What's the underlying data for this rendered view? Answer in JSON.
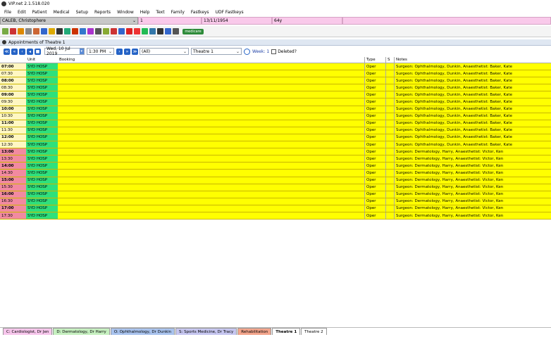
{
  "window": {
    "title": "VIP.net 2.1.518.020"
  },
  "menu": [
    "File",
    "Edit",
    "Patient",
    "Medical",
    "Setup",
    "Reports",
    "Window",
    "Help",
    "Text",
    "Family",
    "Fastkeys",
    "UDF Fastkeys"
  ],
  "patient": {
    "name": "CALEB, Christophere",
    "id": "1",
    "dob": "13/11/1954",
    "age": "64y"
  },
  "toolbar": {
    "logo_text": "medicare"
  },
  "panel": {
    "title": "Appointments of Theatre 1"
  },
  "controls": {
    "date": "Wed, 10 Jul 2019",
    "time": "1:30 PM",
    "filter": "(All)",
    "location": "Theatre 1",
    "week_label": "Week: 1",
    "deleted_label": "Deleted?"
  },
  "grid": {
    "headers": {
      "time": "",
      "unit": "Unit",
      "booking": "Booking",
      "type": "Type",
      "s": "S",
      "notes": "Notes"
    },
    "rows": [
      {
        "time": "07:00",
        "unit": "SYD HOSP",
        "type": "Oper",
        "notes": "Surgeon: Ophthalmology, Dunkin, Anaesthetist: Baker, Kate"
      },
      {
        "time": "07:30",
        "unit": "SYD HOSP",
        "type": "Oper",
        "notes": "Surgeon: Ophthalmology, Dunkin, Anaesthetist: Baker, Kate"
      },
      {
        "time": "08:00",
        "unit": "SYD HOSP",
        "type": "Oper",
        "notes": "Surgeon: Ophthalmology, Dunkin, Anaesthetist: Baker, Kate"
      },
      {
        "time": "08:30",
        "unit": "SYD HOSP",
        "type": "Oper",
        "notes": "Surgeon: Ophthalmology, Dunkin, Anaesthetist: Baker, Kate"
      },
      {
        "time": "09:00",
        "unit": "SYD HOSP",
        "type": "Oper",
        "notes": "Surgeon: Ophthalmology, Dunkin, Anaesthetist: Baker, Kate"
      },
      {
        "time": "09:30",
        "unit": "SYD HOSP",
        "type": "Oper",
        "notes": "Surgeon: Ophthalmology, Dunkin, Anaesthetist: Baker, Kate"
      },
      {
        "time": "10:00",
        "unit": "SYD HOSP",
        "type": "Oper",
        "notes": "Surgeon: Ophthalmology, Dunkin, Anaesthetist: Baker, Kate"
      },
      {
        "time": "10:30",
        "unit": "SYD HOSP",
        "type": "Oper",
        "notes": "Surgeon: Ophthalmology, Dunkin, Anaesthetist: Baker, Kate"
      },
      {
        "time": "11:00",
        "unit": "SYD HOSP",
        "type": "Oper",
        "notes": "Surgeon: Ophthalmology, Dunkin, Anaesthetist: Baker, Kate"
      },
      {
        "time": "11:30",
        "unit": "SYD HOSP",
        "type": "Oper",
        "notes": "Surgeon: Ophthalmology, Dunkin, Anaesthetist: Baker, Kate"
      },
      {
        "time": "12:00",
        "unit": "SYD HOSP",
        "type": "Oper",
        "notes": "Surgeon: Ophthalmology, Dunkin, Anaesthetist: Baker, Kate"
      },
      {
        "time": "12:30",
        "unit": "SYD HOSP",
        "type": "Oper",
        "notes": "Surgeon: Ophthalmology, Dunkin, Anaesthetist: Baker, Kate"
      },
      {
        "time": "13:00",
        "unit": "SYD HOSP",
        "type": "Oper",
        "notes": "Surgeon: Dermatology, Harry, Anaesthetist: Victor, Ken"
      },
      {
        "time": "13:30",
        "unit": "SYD HOSP",
        "type": "Oper",
        "notes": "Surgeon: Dermatology, Harry, Anaesthetist: Victor, Ken"
      },
      {
        "time": "14:00",
        "unit": "SYD HOSP",
        "type": "Oper",
        "notes": "Surgeon: Dermatology, Harry, Anaesthetist: Victor, Ken"
      },
      {
        "time": "14:30",
        "unit": "SYD HOSP",
        "type": "Oper",
        "notes": "Surgeon: Dermatology, Harry, Anaesthetist: Victor, Ken"
      },
      {
        "time": "15:00",
        "unit": "SYD HOSP",
        "type": "Oper",
        "notes": "Surgeon: Dermatology, Harry, Anaesthetist: Victor, Ken"
      },
      {
        "time": "15:30",
        "unit": "SYD HOSP",
        "type": "Oper",
        "notes": "Surgeon: Dermatology, Harry, Anaesthetist: Victor, Ken"
      },
      {
        "time": "16:00",
        "unit": "SYD HOSP",
        "type": "Oper",
        "notes": "Surgeon: Dermatology, Harry, Anaesthetist: Victor, Ken"
      },
      {
        "time": "16:30",
        "unit": "SYD HOSP",
        "type": "Oper",
        "notes": "Surgeon: Dermatology, Harry, Anaesthetist: Victor, Ken"
      },
      {
        "time": "17:00",
        "unit": "SYD HOSP",
        "type": "Oper",
        "notes": "Surgeon: Dermatology, Harry, Anaesthetist: Victor, Ken"
      },
      {
        "time": "17:30",
        "unit": "SYD HOSP",
        "type": "Oper",
        "notes": "Surgeon: Dermatology, Harry, Anaesthetist: Victor, Ken"
      }
    ]
  },
  "tabs": [
    {
      "label": "C: Cardiologist, Dr Jen",
      "color": "#f7c6ec"
    },
    {
      "label": "D: Dermatology, Dr Harry",
      "color": "#c6f0c0"
    },
    {
      "label": "O: Ophthalmology, Dr Dunkin",
      "color": "#a9c3ee"
    },
    {
      "label": "S: Sports Medicine, Dr Tracy",
      "color": "#c6c6f0"
    },
    {
      "label": "Rehabilitation",
      "color": "#f3a58c"
    },
    {
      "label": "Theatre 1",
      "color": "#ffffff",
      "active": true
    },
    {
      "label": "Theatre 2",
      "color": "#ffffff"
    }
  ],
  "colors": {
    "morning_time_bg": "#fff7c2",
    "afternoon_time_bg": "#f28aa0",
    "unit_bg": "#2fe07c",
    "booking_bg": "#ffff00"
  }
}
